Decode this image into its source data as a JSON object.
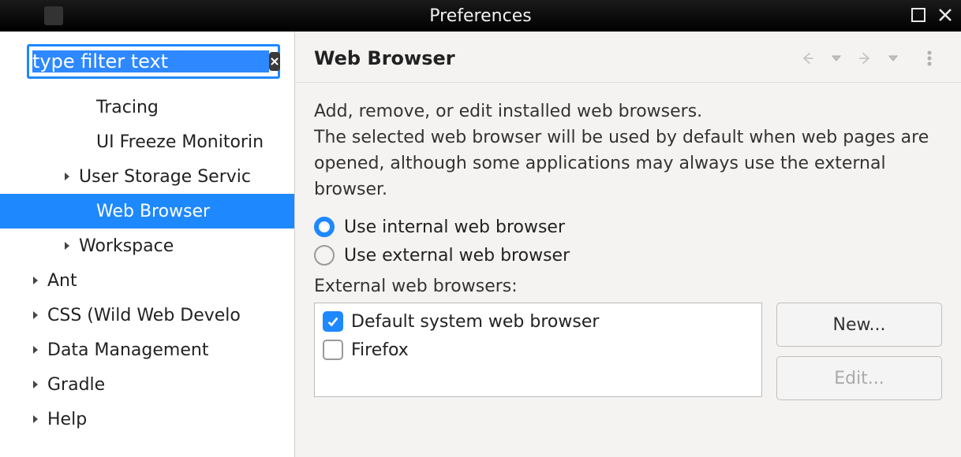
{
  "window": {
    "title": "Preferences"
  },
  "filter": {
    "placeholder": "type filter text",
    "value": "type filter text"
  },
  "tree": [
    {
      "label": "Tracing",
      "indent": 66,
      "arrow": false,
      "selected": false
    },
    {
      "label": "UI Freeze Monitorin",
      "indent": 66,
      "arrow": false,
      "selected": false
    },
    {
      "label": "User Storage Servic",
      "indent": 44,
      "arrow": true,
      "selected": false
    },
    {
      "label": "Web Browser",
      "indent": 66,
      "arrow": false,
      "selected": true
    },
    {
      "label": "Workspace",
      "indent": 44,
      "arrow": true,
      "selected": false
    },
    {
      "label": "Ant",
      "indent": 4,
      "arrow": true,
      "selected": false
    },
    {
      "label": "CSS (Wild Web Develo",
      "indent": 4,
      "arrow": true,
      "selected": false
    },
    {
      "label": "Data Management",
      "indent": 4,
      "arrow": true,
      "selected": false
    },
    {
      "label": "Gradle",
      "indent": 4,
      "arrow": true,
      "selected": false
    },
    {
      "label": "Help",
      "indent": 4,
      "arrow": true,
      "selected": false
    }
  ],
  "page": {
    "heading": "Web Browser",
    "description": "Add, remove, or edit installed web browsers.\nThe selected web browser will be used by default when web pages are opened, although some applications may always use the external browser.",
    "radio_internal": "Use internal web browser",
    "radio_external": "Use external web browser",
    "radio_selected": "internal",
    "external_label": "External web browsers:",
    "browsers": [
      {
        "label": "Default system web browser",
        "checked": true
      },
      {
        "label": "Firefox",
        "checked": false
      }
    ],
    "buttons": {
      "new": "New...",
      "edit": "Edit..."
    }
  }
}
